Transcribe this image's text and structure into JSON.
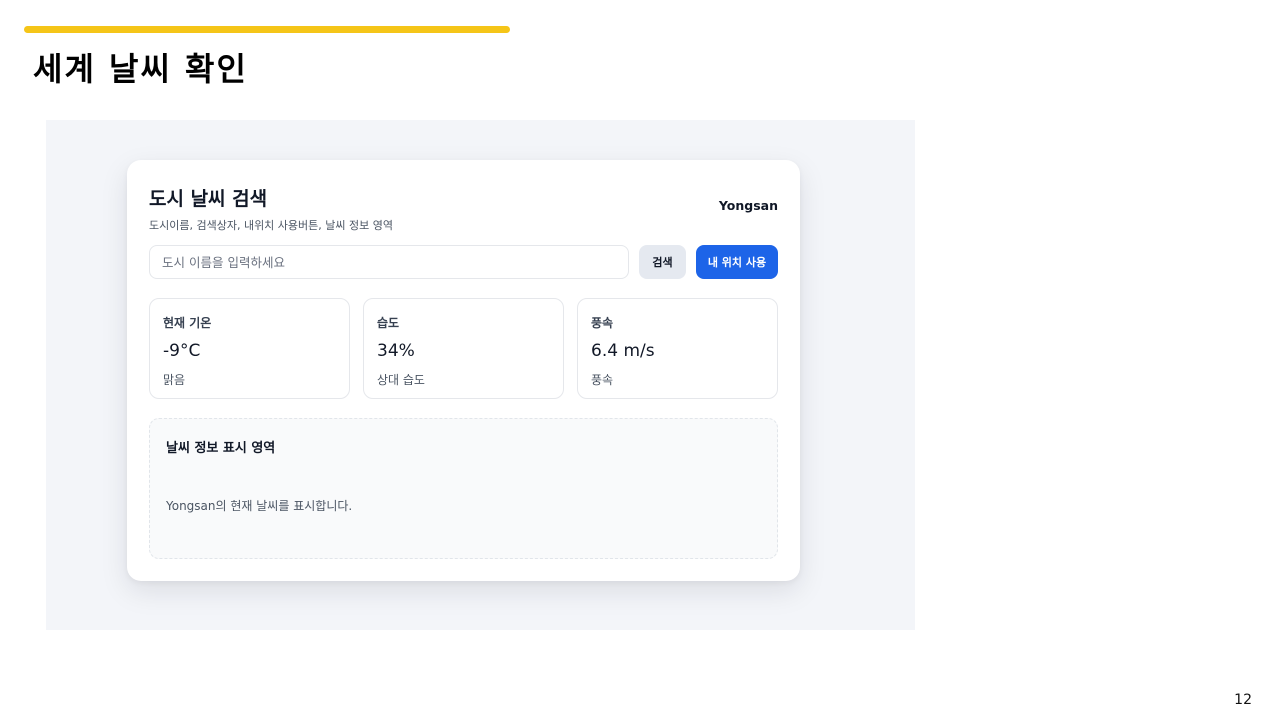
{
  "slide": {
    "title": "세계 날씨 확인",
    "page_number": "12",
    "accent_color": "#f5c518"
  },
  "app": {
    "title": "도시 날씨 검색",
    "subtitle": "도시이름, 검색상자, 내위치 사용버튼, 날씨 정보 영역",
    "city": "Yongsan",
    "search": {
      "placeholder": "도시 이름을 입력하세요",
      "value": "",
      "search_label": "검색",
      "location_label": "내 위치 사용"
    },
    "stats": [
      {
        "label": "현재 기온",
        "value": "-9°C",
        "desc": "맑음"
      },
      {
        "label": "습도",
        "value": "34%",
        "desc": "상대 습도"
      },
      {
        "label": "풍속",
        "value": "6.4 m/s",
        "desc": "풍속"
      }
    ],
    "info": {
      "title": "날씨 정보 표시 영역",
      "text": "Yongsan의 현재 날씨를 표시합니다."
    },
    "colors": {
      "primary": "#1d64e8",
      "secondary_button": "#e5e9f0",
      "background": "#f3f5f9"
    }
  }
}
